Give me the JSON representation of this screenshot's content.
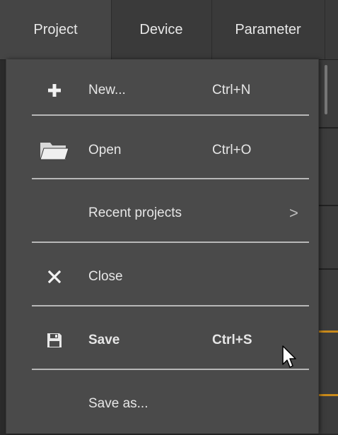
{
  "menubar": {
    "tabs": [
      {
        "label": "Project"
      },
      {
        "label": "Device"
      },
      {
        "label": "Parameter"
      }
    ]
  },
  "dropdown": {
    "items": [
      {
        "label": "New...",
        "shortcut": "Ctrl+N",
        "icon": "plus-icon"
      },
      {
        "label": "Open",
        "shortcut": "Ctrl+O",
        "icon": "folder-icon"
      },
      {
        "label": "Recent projects",
        "submenu_arrow": ">"
      },
      {
        "label": "Close",
        "icon": "close-icon"
      },
      {
        "label": "Save",
        "shortcut": "Ctrl+S",
        "icon": "save-icon",
        "hovered": true
      },
      {
        "label": "Save as..."
      }
    ]
  },
  "colors": {
    "menubar_bg": "#3a3a3a",
    "dropdown_bg": "#4a4a4a",
    "separator": "#b8b8b8",
    "text": "#e6e6e6",
    "accent": "#c98a1b"
  }
}
